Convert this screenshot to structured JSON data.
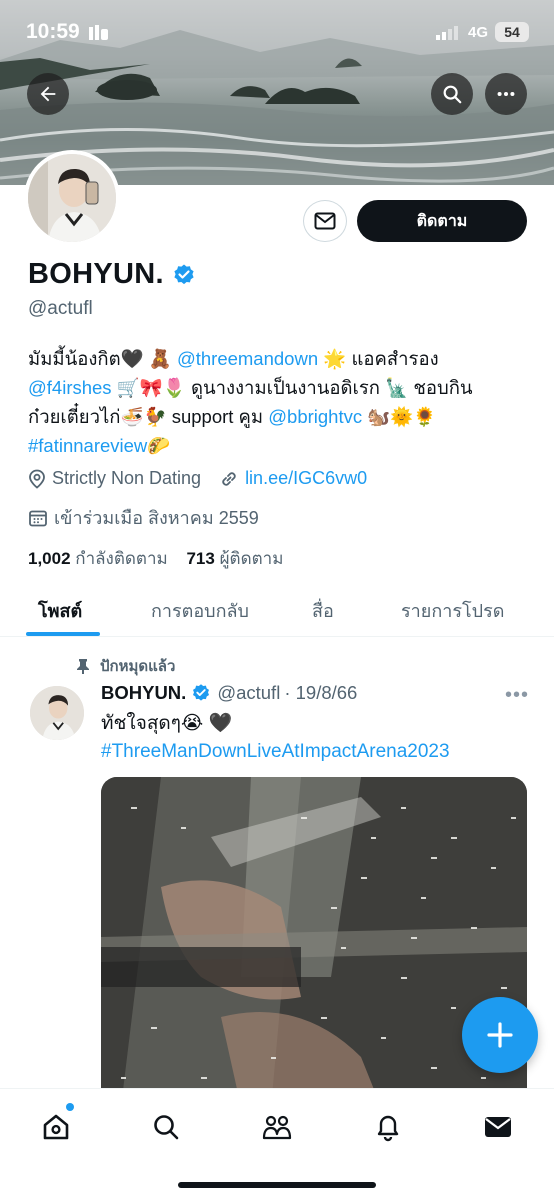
{
  "status_bar": {
    "time": "10:59",
    "network": "4G",
    "battery": "54"
  },
  "header": {
    "back_icon": "arrow-left-icon",
    "search_icon": "search-icon",
    "more_icon": "more-horizontal-icon"
  },
  "profile": {
    "display_name": "BOHYUN.",
    "handle": "@actufl",
    "follow_label": "ติดตาม",
    "bio": {
      "line1_a": "มัมมี้น้องกิต🖤 🧸 ",
      "line1_link": "@threemandown",
      "line1_b": " 🌟 แอคสำรอง",
      "line2_link": "@f4irshes",
      "line2_b": " 🛒🎀🌷 ดูนางงามเป็นงานอดิเรก 🗽 ชอบกิน",
      "line3_a": "ก๋วยเตี๋ยวไก่🍜🐓 support คูม ",
      "line3_link": "@bbrightvc",
      "line3_b": " 🐿️🌞🌻",
      "line4_link": "#fatinnareview",
      "line4_b": "🌮"
    },
    "location": "Strictly Non Dating",
    "website": "lin.ee/IGC6vw0",
    "joined": "เข้าร่วมเมือ สิงหาคม 2559",
    "following_count": "1,002",
    "following_label": "กำลังติดตาม",
    "followers_count": "713",
    "followers_label": "ผู้ติดตาม"
  },
  "tabs": [
    {
      "label": "โพสต์",
      "active": true
    },
    {
      "label": "การตอบกลับ",
      "active": false
    },
    {
      "label": "สื่อ",
      "active": false
    },
    {
      "label": "รายการโปรด",
      "active": false
    }
  ],
  "post": {
    "pinned_label": "ปักหมุดแล้ว",
    "author_name": "BOHYUN.",
    "author_handle": "@actufl",
    "date": "· 19/8/66",
    "text": "ทัชใจสุดๆ😭 🖤",
    "hashtag": "#ThreeManDownLiveAtImpactArena2023"
  },
  "nav": {
    "items": [
      "home-icon",
      "search-icon",
      "communities-icon",
      "notifications-icon",
      "messages-icon"
    ]
  },
  "colors": {
    "accent": "#1d9bf0",
    "text": "#0f1419",
    "muted": "#536471"
  }
}
